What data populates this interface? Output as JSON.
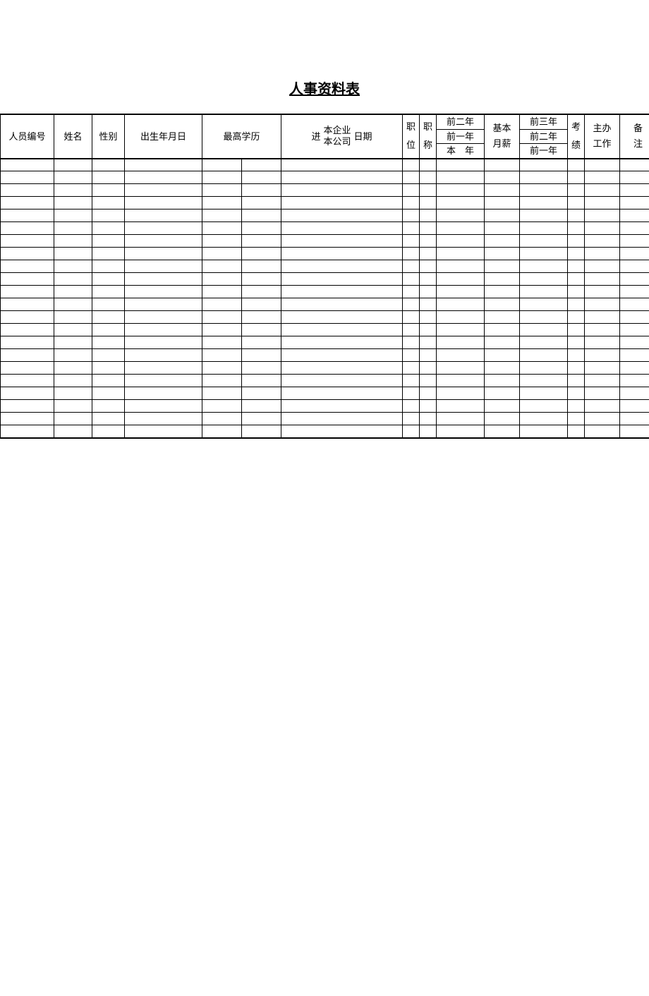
{
  "title": "人事资料表",
  "columns": {
    "c1": "人员编号",
    "c2": "姓名",
    "c3": "性别",
    "c4": "出生年月日",
    "c5": "最高学历",
    "c6_left": "进",
    "c6_mid_top": "本企业",
    "c6_mid_bot": "本公司",
    "c6_right": "日期",
    "c7_top": "职",
    "c7_bot": "位",
    "c8_top": "职",
    "c8_bot": "称",
    "c9_r1": "前二年",
    "c9_r2": "前一年",
    "c9_r3": "本　年",
    "c10_top": "基本",
    "c10_bot": "月薪",
    "c11_r1": "前三年",
    "c11_r2": "前二年",
    "c11_r3": "前一年",
    "c12_top": "考",
    "c12_bot": "绩",
    "c13_top": "主办",
    "c13_bot": "工作",
    "c14_top": "备",
    "c14_bot": "注"
  },
  "row_count": 22
}
